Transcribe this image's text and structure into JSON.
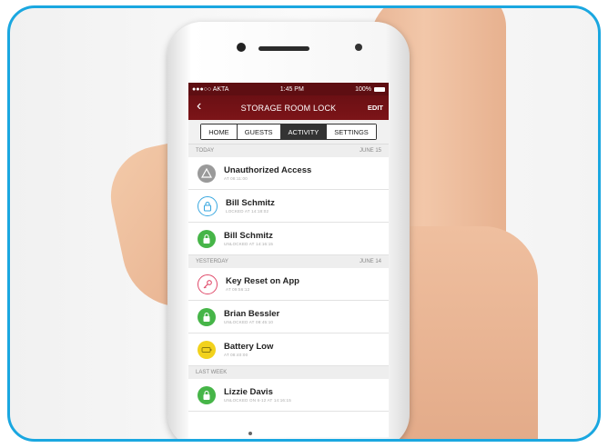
{
  "statusbar": {
    "carrier": "●●●○○ AKTA",
    "time": "1:45 PM",
    "battery": "100%"
  },
  "nav": {
    "back": "‹",
    "title": "STORAGE ROOM LOCK",
    "edit": "EDIT"
  },
  "tabs": [
    {
      "label": "HOME",
      "active": false
    },
    {
      "label": "GUESTS",
      "active": false
    },
    {
      "label": "ACTIVITY",
      "active": true
    },
    {
      "label": "SETTINGS",
      "active": false
    }
  ],
  "sections": [
    {
      "label": "TODAY",
      "date": "JUNE 15",
      "items": [
        {
          "title": "Unauthorized Access",
          "sub": "AT 08:11:00",
          "icon": "warning-icon",
          "color": "#9a9a9a"
        },
        {
          "title": "Bill Schmitz",
          "sub": "LOCKED AT 14:18:02",
          "icon": "lock-icon",
          "color": "#3aa8e0"
        },
        {
          "title": "Bill Schmitz",
          "sub": "UNLOCKED AT 14:16:15",
          "icon": "unlock-icon",
          "color": "#46b548"
        }
      ]
    },
    {
      "label": "YESTERDAY",
      "date": "JUNE 14",
      "items": [
        {
          "title": "Key Reset on App",
          "sub": "AT 09:56:12",
          "icon": "key-icon",
          "color": "#e04a6a"
        },
        {
          "title": "Brian Bessler",
          "sub": "UNLOCKED AT 08:45:10",
          "icon": "unlock-icon",
          "color": "#46b548"
        },
        {
          "title": "Battery Low",
          "sub": "AT 08:40:00",
          "icon": "battery-icon",
          "color": "#f2d21c"
        }
      ]
    },
    {
      "label": "LAST WEEK",
      "date": "",
      "items": [
        {
          "title": "Lizzie Davis",
          "sub": "UNLOCKED ON 6-12 AT 14:16:15",
          "icon": "unlock-icon",
          "color": "#46b548"
        }
      ]
    }
  ]
}
